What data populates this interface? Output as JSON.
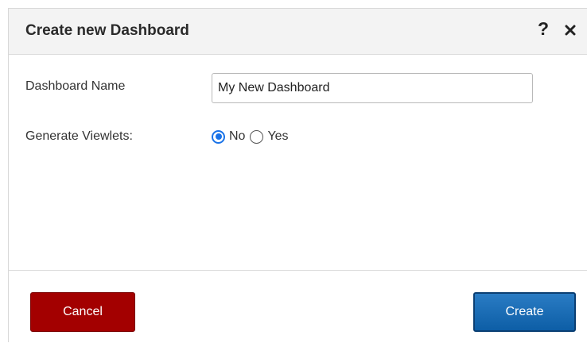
{
  "dialog": {
    "title": "Create new Dashboard",
    "help_icon": "?",
    "close_icon_name": "close-icon"
  },
  "form": {
    "name_label": "Dashboard Name",
    "name_value": "My New Dashboard",
    "viewlets_label": "Generate Viewlets:",
    "viewlets_options": [
      {
        "label": "No",
        "selected": true
      },
      {
        "label": "Yes",
        "selected": false
      }
    ]
  },
  "buttons": {
    "cancel_label": "Cancel",
    "create_label": "Create"
  },
  "colors": {
    "header_bg": "#f3f3f3",
    "cancel_bg": "#a30000",
    "create_bg": "#1a6bb5",
    "radio_accent": "#1a73e8"
  }
}
